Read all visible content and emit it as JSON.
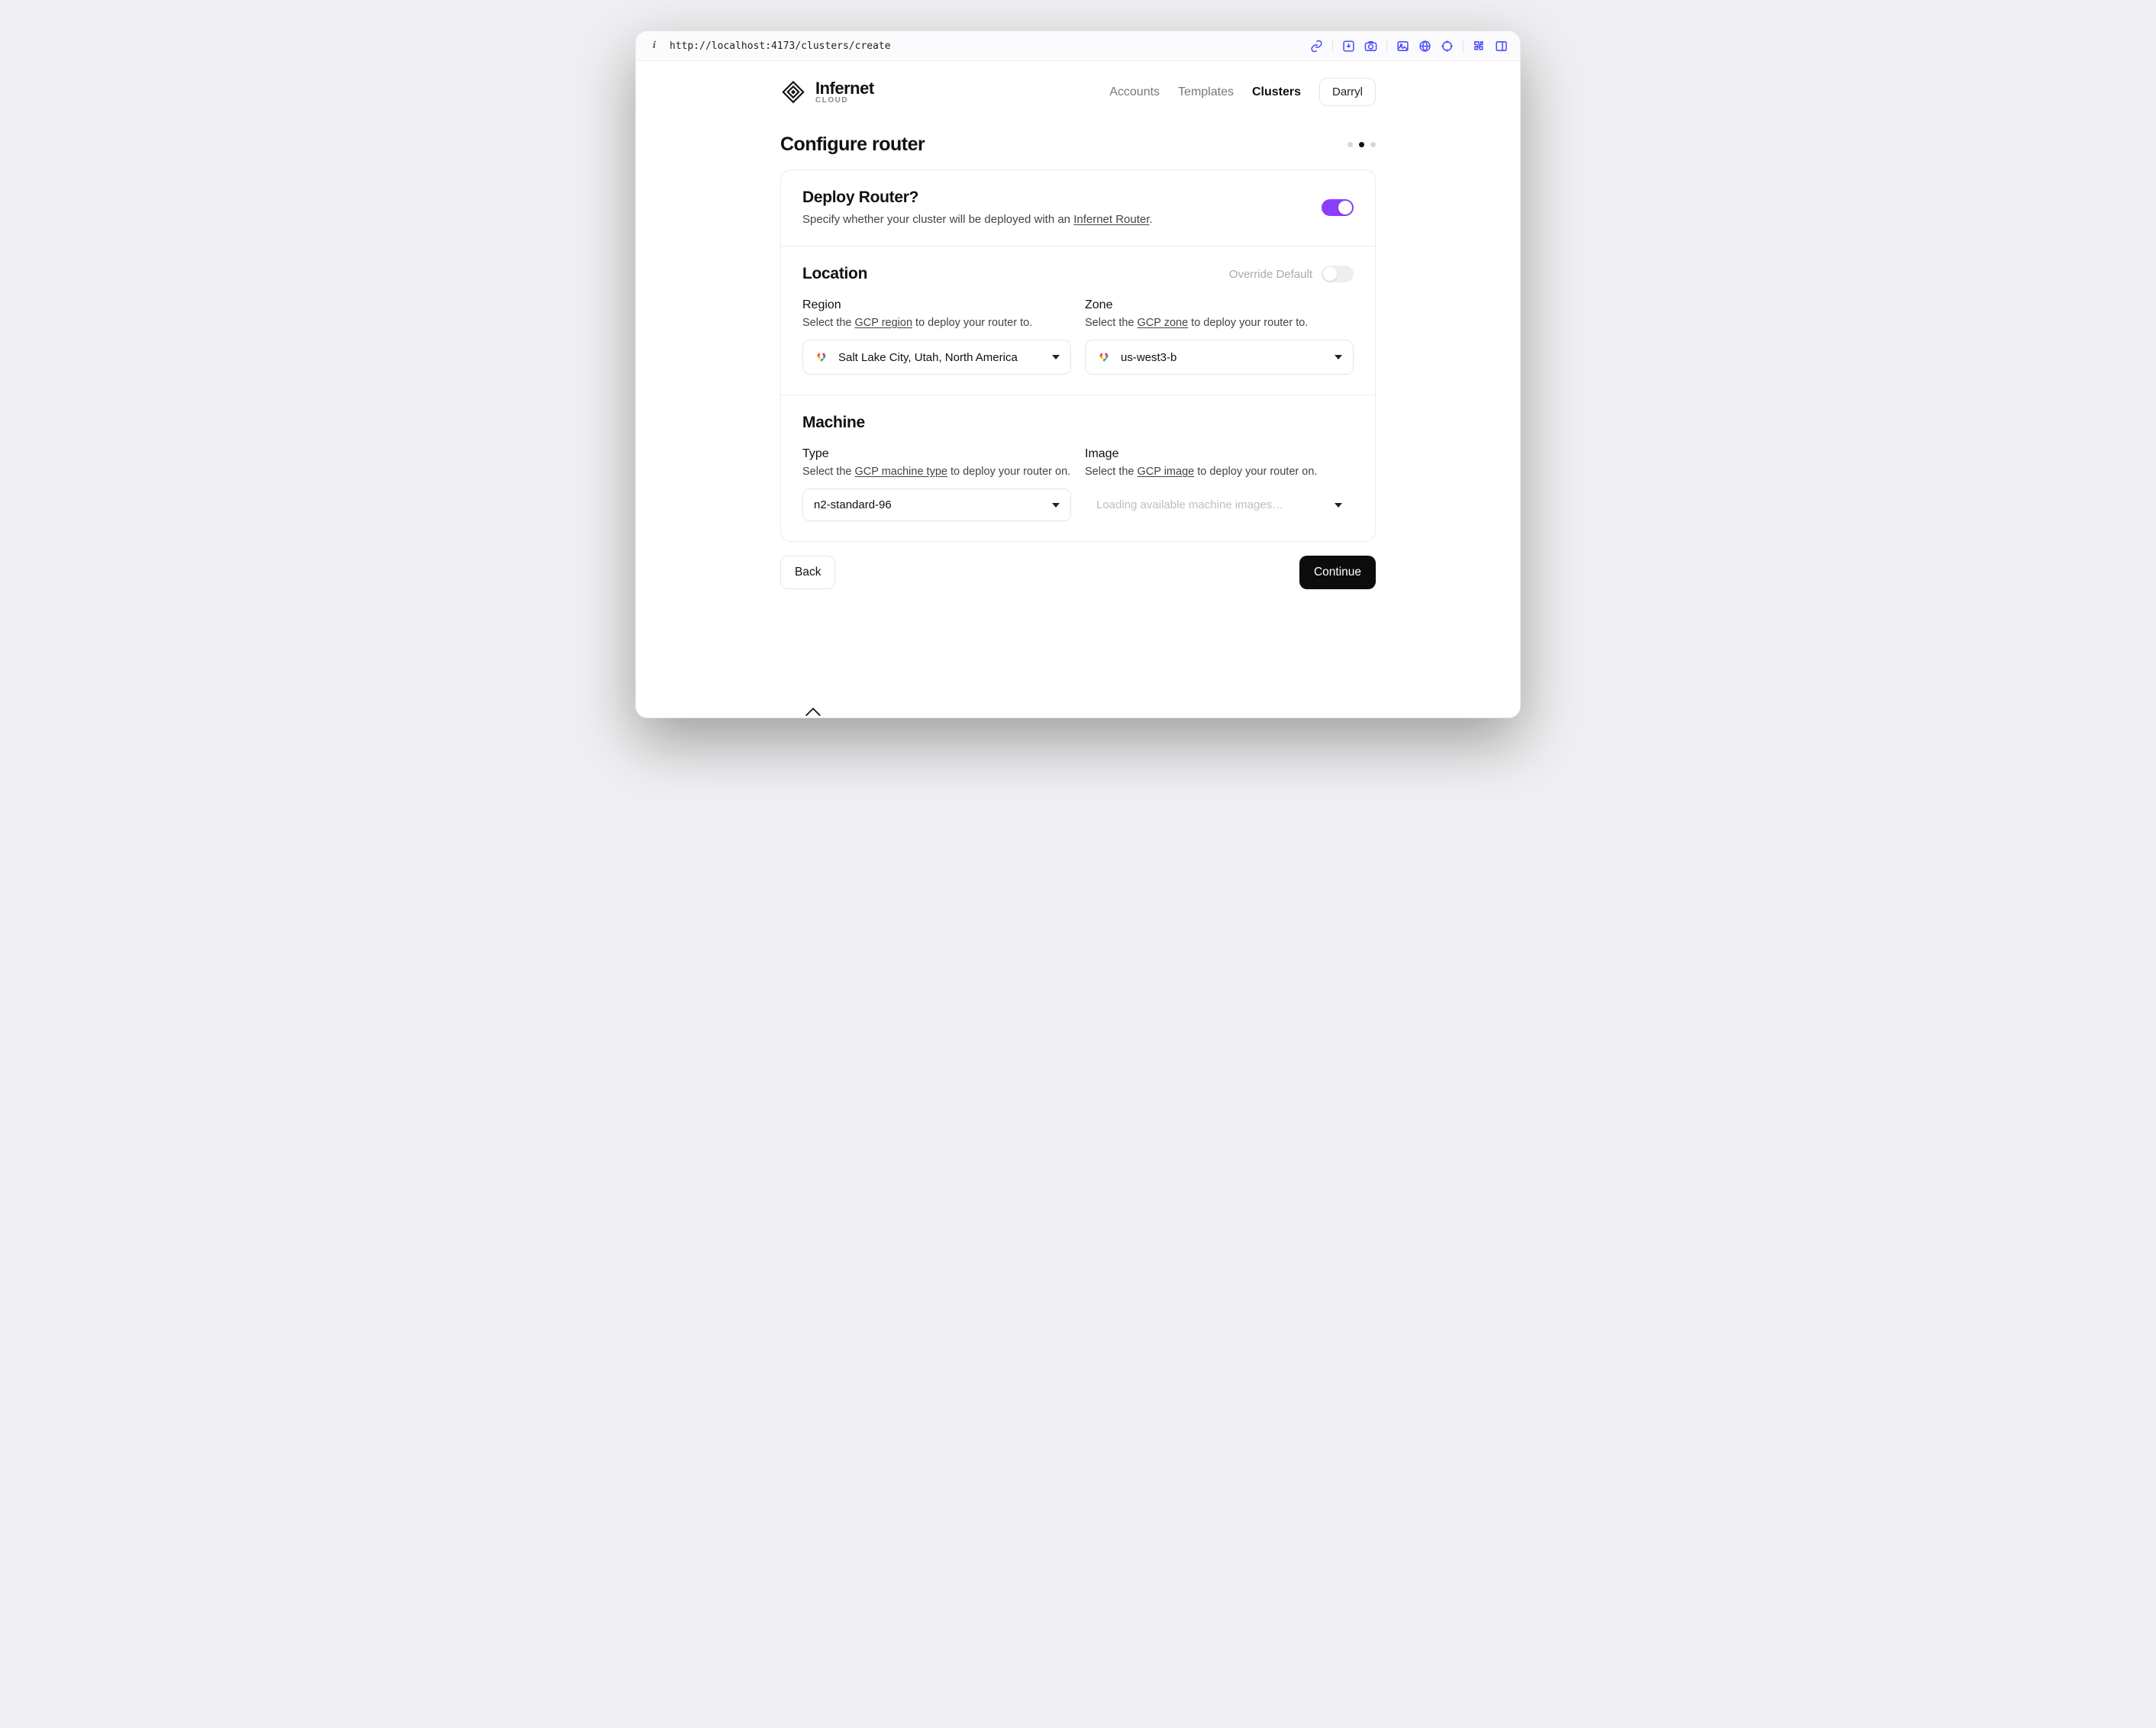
{
  "browser": {
    "url": "http://localhost:4173/clusters/create"
  },
  "brand": {
    "name": "Infernet",
    "sub": "CLOUD"
  },
  "nav": {
    "accounts": "Accounts",
    "templates": "Templates",
    "clusters": "Clusters",
    "user": "Darryl"
  },
  "page": {
    "title": "Configure router",
    "step_active": 2,
    "steps": 3
  },
  "deploy": {
    "title": "Deploy Router?",
    "desc_prefix": "Specify whether your cluster will be deployed with an ",
    "desc_link": "Infernet Router",
    "desc_suffix": ".",
    "enabled": true
  },
  "location": {
    "title": "Location",
    "override_label": "Override Default",
    "override_on": false,
    "region": {
      "label": "Region",
      "desc_prefix": "Select the ",
      "desc_link": "GCP region",
      "desc_suffix": " to deploy your router to.",
      "value": "Salt Lake City, Utah, North America"
    },
    "zone": {
      "label": "Zone",
      "desc_prefix": "Select the ",
      "desc_link": "GCP zone",
      "desc_suffix": " to deploy your router to.",
      "value": "us-west3-b"
    }
  },
  "machine": {
    "title": "Machine",
    "type": {
      "label": "Type",
      "desc_prefix": "Select the ",
      "desc_link": "GCP machine type",
      "desc_suffix": " to deploy your router on.",
      "value": "n2-standard-96"
    },
    "image": {
      "label": "Image",
      "desc_prefix": "Select the ",
      "desc_link": "GCP image",
      "desc_suffix": " to deploy your router on.",
      "placeholder": "Loading available machine images…"
    }
  },
  "actions": {
    "back": "Back",
    "continue": "Continue"
  }
}
